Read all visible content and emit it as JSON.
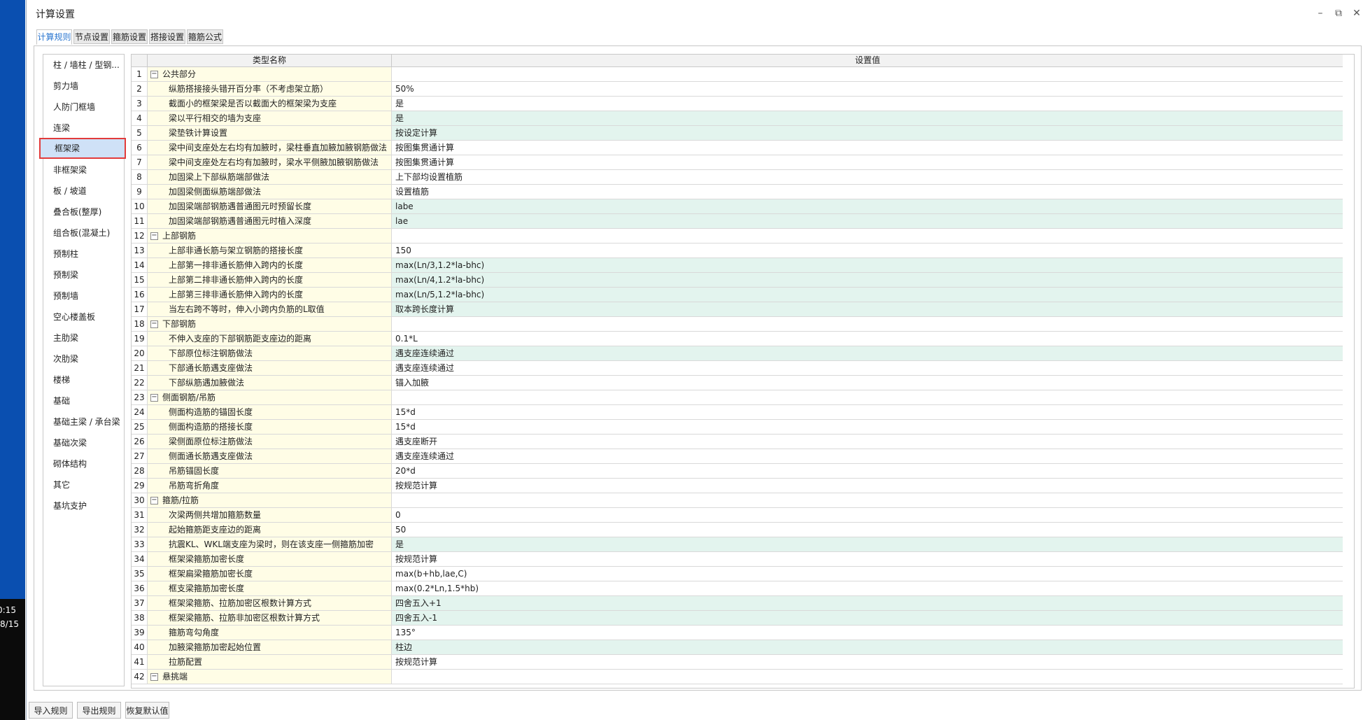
{
  "taskbar": {
    "time": "0:15",
    "date": "/8/15"
  },
  "window": {
    "title": "计算设置",
    "minimize": "–",
    "restore": "⧉",
    "close": "✕"
  },
  "tabs": [
    "计算规则",
    "节点设置",
    "箍筋设置",
    "搭接设置",
    "箍筋公式"
  ],
  "active_tab": 0,
  "sidebar": {
    "selected": 4,
    "items": [
      "柱 / 墙柱 / 型钢...",
      "剪力墙",
      "人防门框墙",
      "连梁",
      "框架梁",
      "非框架梁",
      "板 / 坡道",
      "叠合板(整厚)",
      "组合板(混凝土)",
      "预制柱",
      "预制梁",
      "预制墙",
      "空心楼盖板",
      "主肋梁",
      "次肋梁",
      "楼梯",
      "基础",
      "基础主梁 / 承台梁",
      "基础次梁",
      "砌体结构",
      "其它",
      "基坑支护"
    ]
  },
  "grid": {
    "headers": {
      "name": "类型名称",
      "value": "设置值"
    },
    "rows": [
      {
        "n": "1",
        "group": true,
        "name": "公共部分",
        "value": ""
      },
      {
        "n": "2",
        "name": "纵筋搭接接头错开百分率（不考虑架立筋）",
        "value": "50%"
      },
      {
        "n": "3",
        "name": "截面小的框架梁是否以截面大的框架梁为支座",
        "value": "是"
      },
      {
        "n": "4",
        "name": "梁以平行相交的墙为支座",
        "value": "是",
        "green": true
      },
      {
        "n": "5",
        "name": "梁垫铁计算设置",
        "value": "按设定计算",
        "green": true
      },
      {
        "n": "6",
        "name": "梁中间支座处左右均有加腋时，梁柱垂直加腋加腋钢筋做法",
        "value": "按图集贯通计算"
      },
      {
        "n": "7",
        "name": "梁中间支座处左右均有加腋时，梁水平侧腋加腋钢筋做法",
        "value": "按图集贯通计算"
      },
      {
        "n": "8",
        "name": "加固梁上下部纵筋端部做法",
        "value": "上下部均设置植筋"
      },
      {
        "n": "9",
        "name": "加固梁侧面纵筋端部做法",
        "value": "设置植筋"
      },
      {
        "n": "10",
        "name": "加固梁端部钢筋遇普通图元时预留长度",
        "value": "labe",
        "green": true
      },
      {
        "n": "11",
        "name": "加固梁端部钢筋遇普通图元时植入深度",
        "value": "lae",
        "green": true
      },
      {
        "n": "12",
        "group": true,
        "name": "上部钢筋",
        "value": ""
      },
      {
        "n": "13",
        "name": "上部非通长筋与架立钢筋的搭接长度",
        "value": "150"
      },
      {
        "n": "14",
        "name": "上部第一排非通长筋伸入跨内的长度",
        "value": "max(Ln/3,1.2*la-bhc)",
        "green": true
      },
      {
        "n": "15",
        "name": "上部第二排非通长筋伸入跨内的长度",
        "value": "max(Ln/4,1.2*la-bhc)",
        "green": true
      },
      {
        "n": "16",
        "name": "上部第三排非通长筋伸入跨内的长度",
        "value": "max(Ln/5,1.2*la-bhc)",
        "green": true
      },
      {
        "n": "17",
        "name": "当左右跨不等时，伸入小跨内负筋的L取值",
        "value": "取本跨长度计算",
        "green": true
      },
      {
        "n": "18",
        "group": true,
        "name": "下部钢筋",
        "value": ""
      },
      {
        "n": "19",
        "name": "不伸入支座的下部钢筋距支座边的距离",
        "value": "0.1*L"
      },
      {
        "n": "20",
        "name": "下部原位标注钢筋做法",
        "value": "遇支座连续通过",
        "green": true
      },
      {
        "n": "21",
        "name": "下部通长筋遇支座做法",
        "value": "遇支座连续通过"
      },
      {
        "n": "22",
        "name": "下部纵筋遇加腋做法",
        "value": "锚入加腋"
      },
      {
        "n": "23",
        "group": true,
        "name": "侧面钢筋/吊筋",
        "value": ""
      },
      {
        "n": "24",
        "name": "侧面构造筋的锚固长度",
        "value": "15*d"
      },
      {
        "n": "25",
        "name": "侧面构造筋的搭接长度",
        "value": "15*d"
      },
      {
        "n": "26",
        "name": "梁侧面原位标注筋做法",
        "value": "遇支座断开"
      },
      {
        "n": "27",
        "name": "侧面通长筋遇支座做法",
        "value": "遇支座连续通过"
      },
      {
        "n": "28",
        "name": "吊筋锚固长度",
        "value": "20*d"
      },
      {
        "n": "29",
        "name": "吊筋弯折角度",
        "value": "按规范计算"
      },
      {
        "n": "30",
        "group": true,
        "name": "箍筋/拉筋",
        "value": ""
      },
      {
        "n": "31",
        "name": "次梁两侧共增加箍筋数量",
        "value": "0"
      },
      {
        "n": "32",
        "name": "起始箍筋距支座边的距离",
        "value": "50"
      },
      {
        "n": "33",
        "name": "抗震KL、WKL端支座为梁时，则在该支座一侧箍筋加密",
        "value": "是",
        "green": true
      },
      {
        "n": "34",
        "name": "框架梁箍筋加密长度",
        "value": "按规范计算"
      },
      {
        "n": "35",
        "name": "框架扁梁箍筋加密长度",
        "value": "max(b+hb,lae,C)"
      },
      {
        "n": "36",
        "name": "框支梁箍筋加密长度",
        "value": "max(0.2*Ln,1.5*hb)"
      },
      {
        "n": "37",
        "name": "框架梁箍筋、拉筋加密区根数计算方式",
        "value": "四舍五入+1",
        "green": true
      },
      {
        "n": "38",
        "name": "框架梁箍筋、拉筋非加密区根数计算方式",
        "value": "四舍五入-1",
        "green": true
      },
      {
        "n": "39",
        "name": "箍筋弯勾角度",
        "value": "135°"
      },
      {
        "n": "40",
        "name": "加腋梁箍筋加密起始位置",
        "value": "柱边",
        "green": true
      },
      {
        "n": "41",
        "name": "拉筋配置",
        "value": "按规范计算"
      },
      {
        "n": "42",
        "group": true,
        "name": "悬挑端",
        "value": ""
      }
    ]
  },
  "buttons": [
    "导入规则",
    "导出规则",
    "恢复默认值"
  ]
}
